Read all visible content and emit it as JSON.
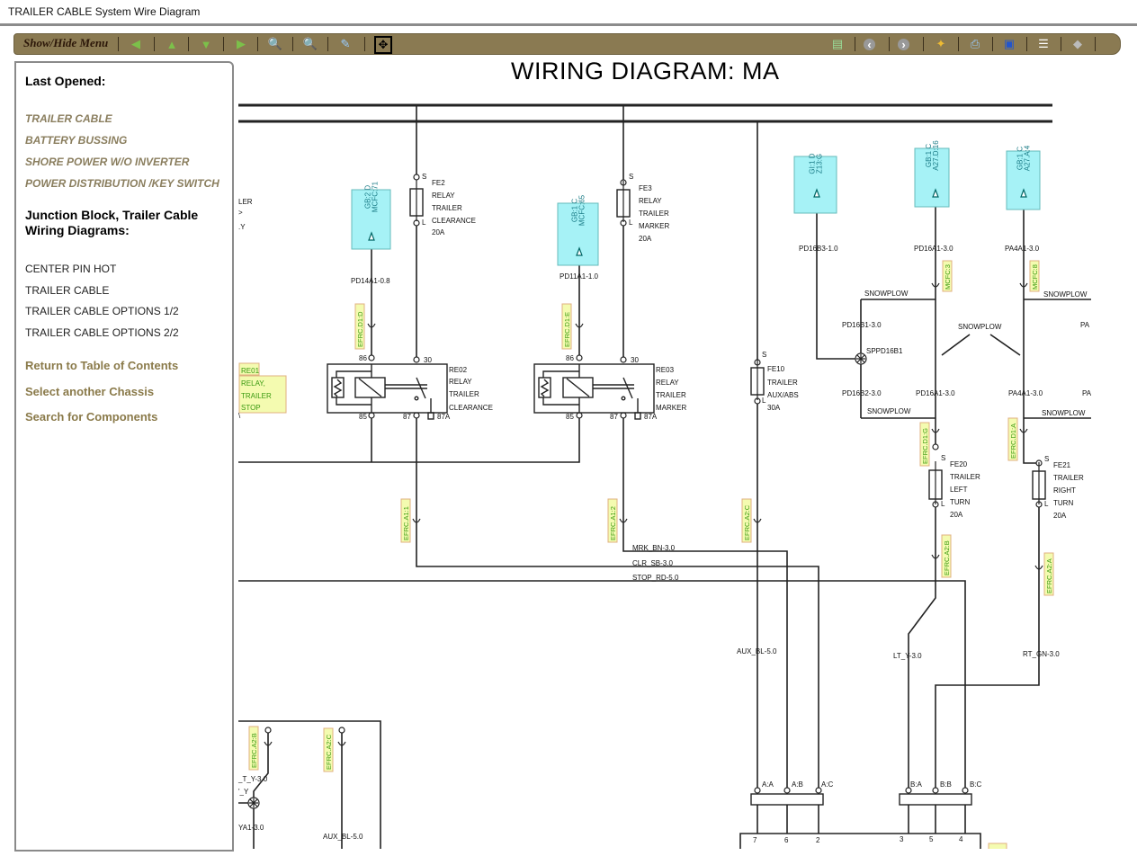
{
  "window": {
    "title": "TRAILER CABLE System Wire Diagram"
  },
  "toolbar": {
    "menu_label": "Show/Hide Menu",
    "left_icons": [
      "arrow-left-icon",
      "arrow-up-icon",
      "arrow-down-icon",
      "arrow-right-icon",
      "zoom-in-icon",
      "zoom-out-icon",
      "zoom-area-icon",
      "fit-to-window-icon"
    ],
    "right_icons": [
      "layout-icon",
      "back-circle-icon",
      "forward-circle-icon",
      "components-icon",
      "print-icon",
      "image-icon",
      "list-icon",
      "info-icon"
    ],
    "color": "#8a7a52"
  },
  "sidebar": {
    "last_opened_heading": "Last Opened:",
    "recent": [
      "TRAILER CABLE",
      "BATTERY BUSSING",
      "SHORE POWER W/O INVERTER",
      "POWER DISTRIBUTION /KEY SWITCH"
    ],
    "section_heading_1": "Junction Block, Trailer Cable",
    "section_heading_2": "Wiring Diagrams:",
    "diagrams": [
      "CENTER PIN HOT",
      "TRAILER CABLE",
      "TRAILER CABLE OPTIONS 1/2",
      "TRAILER CABLE OPTIONS 2/2"
    ],
    "links": [
      "Return to Table of Contents",
      "Select another Chassis",
      "Search for Components"
    ],
    "link_color": "#8a7a4a"
  },
  "diagram": {
    "title": "WIRING DIAGRAM: MA",
    "colors": {
      "ref_box": "#a6f2f6",
      "tag_fill": "#f4fbb0",
      "tag_border": "#e0b080",
      "tag_text": "#3a9a10"
    },
    "labels": {
      "fe2_s": "S",
      "fe2_name": "FE2",
      "fe2_l1": "RELAY",
      "fe2_l2": "TRAILER",
      "fe2_l3": "CLEARANCE",
      "fe2_amp": "20A",
      "fe2_l": "L",
      "pd14": "PD14A1-0.8",
      "re02_86": "86",
      "re02_30": "30",
      "re02_85": "85",
      "re02_87": "87",
      "re02_87a": "87A",
      "re02_name": "RE02",
      "re02_l1": "RELAY",
      "re02_l2": "TRAILER",
      "re02_l3": "CLEARANCE",
      "fe3_s": "S",
      "fe3_name": "FE3",
      "fe3_l1": "RELAY",
      "fe3_l2": "TRAILER",
      "fe3_l3": "MARKER",
      "fe3_amp": "20A",
      "fe3_l": "L",
      "pd11": "PD11A1-1.0",
      "re03_86": "86",
      "re03_30": "30",
      "re03_85": "85",
      "re03_87": "87",
      "re03_87a": "87A",
      "re03_name": "RE03",
      "re03_l1": "RELAY",
      "re03_l2": "TRAILER",
      "re03_l3": "MARKER",
      "fe10_s": "S",
      "fe10_name": "FE10",
      "fe10_l1": "TRAILER",
      "fe10_l2": "AUX/ABS",
      "fe10_amp": "30A",
      "fe10_l": "L",
      "pd16b3": "PD16B3-1.0",
      "pd16a1_top": "PD16A1-3.0",
      "pa4a1_top": "PA4A1-3.0",
      "snow1": "SNOWPLOW",
      "snow2": "SNOWPLOW",
      "pd16b1": "PD16B1-3.0",
      "snow3": "SNOWPLOW",
      "pa_r1": "PA",
      "sppd16b1": "SPPD16B1",
      "pd16b2": "PD16B2-3.0",
      "pd16a1_bot": "PD16A1-3.0",
      "pa4a1_bot": "PA4A1-3.0",
      "pa_r2": "PA",
      "snow4": "SNOWPLOW",
      "snow5": "SNOWPLOW",
      "fe20_s": "S",
      "fe20_name": "FE20",
      "fe20_l1": "TRAILER",
      "fe20_l2": "LEFT",
      "fe20_l3": "TURN",
      "fe20_amp": "20A",
      "fe20_l": "L",
      "fe21_s": "S",
      "fe21_name": "FE21",
      "fe21_l1": "TRAILER",
      "fe21_l2": "RIGHT",
      "fe21_l3": "TURN",
      "fe21_amp": "20A",
      "fe21_l": "L",
      "mrk": "MRK_BN-3.0",
      "clr": "CLR_SB-3.0",
      "stop": "STOP_RD-5.0",
      "aux": "AUX_BL-5.0",
      "lt": "LT_Y-3.0",
      "rt": "RT_GN-3.0",
      "aa": "A:A",
      "ab": "A:B",
      "ac": "A:C",
      "ba": "B:A",
      "bb": "B:B",
      "bc": "B:C",
      "p7": "7",
      "p6": "6",
      "p2": "2",
      "p3": "3",
      "p5": "5",
      "p4": "4",
      "bl_lt": "_T_Y-3.0",
      "bl_y": "'_Y",
      "bl_ya": "YA1-3.0",
      "bl_aux": "AUX_BL-5.0",
      "frag_ler": "LER",
      "frag_gt": ">",
      "frag_y": ".Y",
      "frag_bs": "\\"
    },
    "ref_boxes": [
      [
        "GB:2 D",
        "MCFC:71"
      ],
      [
        "GB:1 C",
        "MCFC:65"
      ],
      [
        "GI:1 D",
        "Z13:G"
      ],
      [
        "GB:1 C",
        "A27.D:16"
      ],
      [
        "GB:1 C",
        "A27.A:4"
      ]
    ],
    "tags": [
      "EFRC.D1:D",
      "EFRC.D1:E",
      "EFRC.A1:1",
      "EFRC.A1:2",
      "EFRC.A2:C",
      "MCFC:3",
      "MCFC:8",
      "EFRC.D1:G",
      "EFRC.D1:A",
      "EFRC.A2:B",
      "EFRC.A2:A",
      "EFRC.A2:B",
      "EFRC.A2:C"
    ],
    "re01": [
      "RE01",
      "RELAY,",
      "TRAILER",
      "STOP"
    ]
  }
}
